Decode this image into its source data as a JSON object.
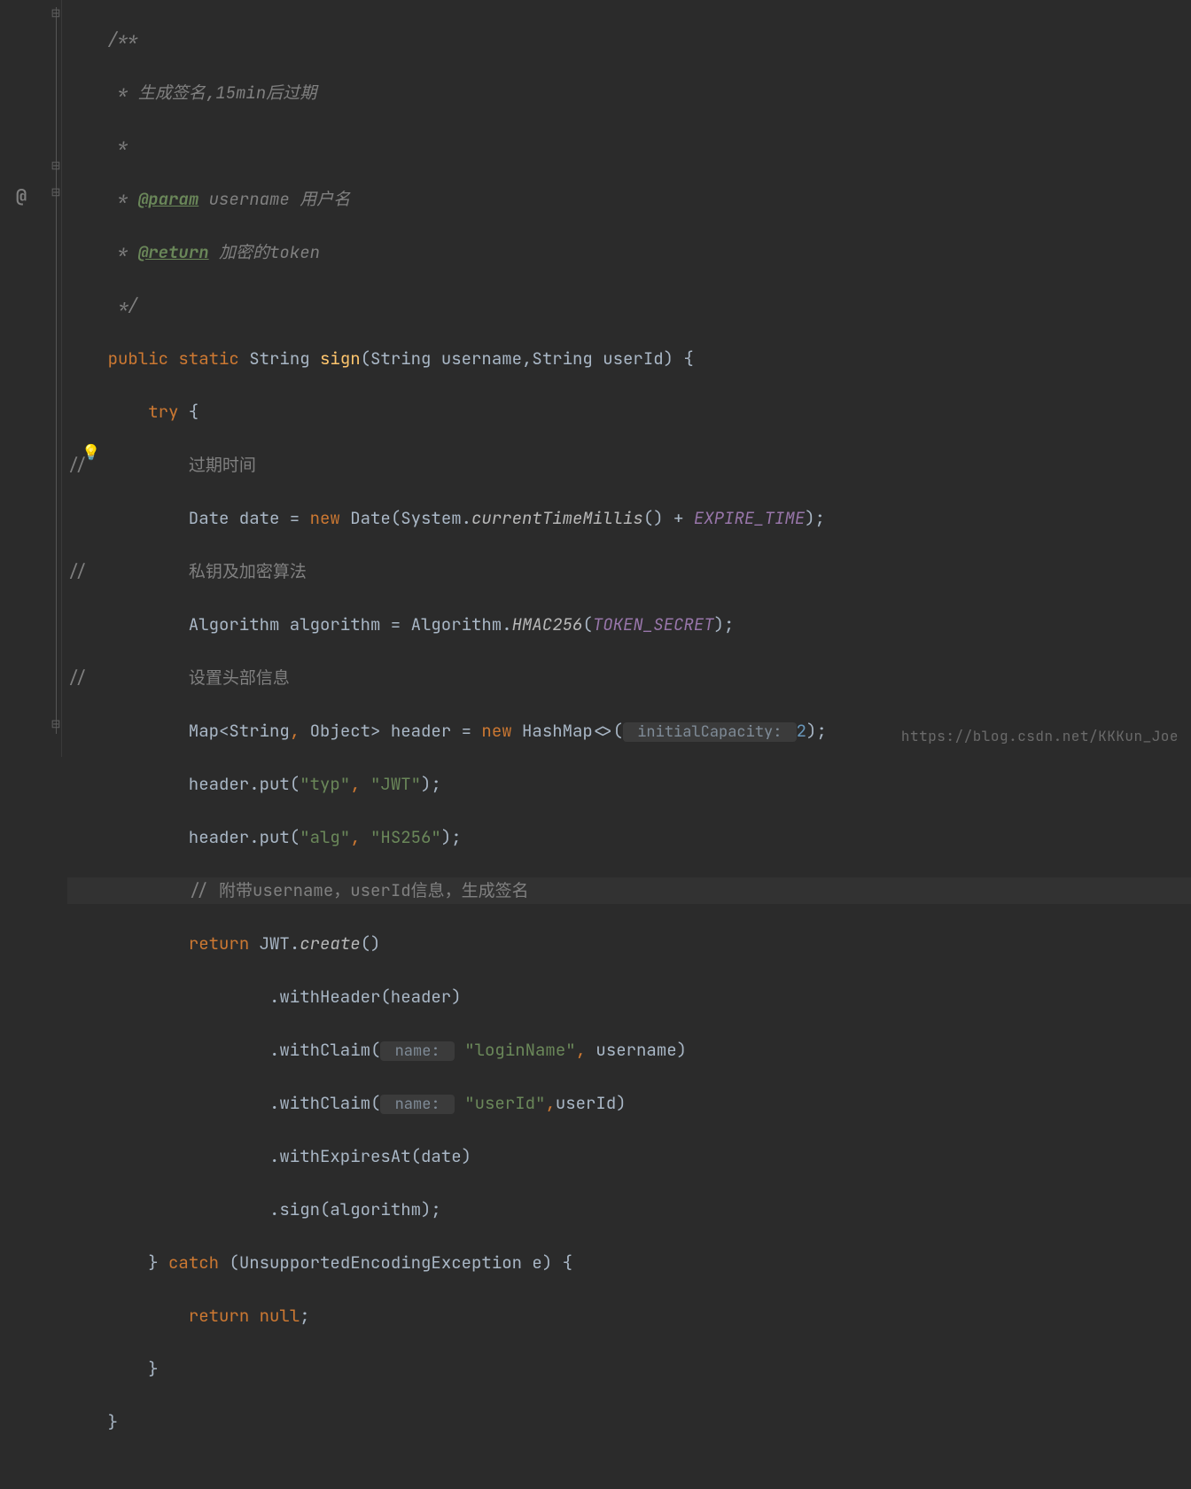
{
  "lines": {
    "l1": "    /**",
    "l2a": "     * ",
    "l2b": "生成签名,15min后过期",
    "l3": "     *",
    "l4a": "     * ",
    "l4b": "@param",
    "l4c": " username ",
    "l4d": "用户名",
    "l5a": "     * ",
    "l5b": "@return",
    "l5c": " 加密的token",
    "l6": "     */",
    "l7a": "    ",
    "l7b": "public static",
    "l7c": " String ",
    "l7d": "sign",
    "l7e": "(String username,String userId) {",
    "l8a": "        ",
    "l8b": "try",
    "l8c": " {",
    "l9a": "//          ",
    "l9b": "过期时间",
    "l10a": "            Date date = ",
    "l10b": "new",
    "l10c": " Date(System.",
    "l10d": "currentTimeMillis",
    "l10e": "() + ",
    "l10f": "EXPIRE_TIME",
    "l10g": ");",
    "l11a": "//          ",
    "l11b": "私钥及加密算法",
    "l12a": "            Algorithm algorithm = Algorithm.",
    "l12b": "HMAC256",
    "l12c": "(",
    "l12d": "TOKEN_SECRET",
    "l12e": ");",
    "l13a": "//          ",
    "l13b": "设置头部信息",
    "l14a": "            Map<String",
    "l14comma1": ",",
    "l14b": " Object> header = ",
    "l14c": "new",
    "l14d": " HashMap<>(",
    "l14hint": " initialCapacity: ",
    "l14e": "2",
    "l14f": ");",
    "l15a": "            header.put(",
    "l15b": "\"typ\"",
    "l15comma": ",",
    "l15c": " ",
    "l15d": "\"JWT\"",
    "l15e": ");",
    "l16a": "            header.put(",
    "l16b": "\"alg\"",
    "l16comma": ",",
    "l16c": " ",
    "l16d": "\"HS256\"",
    "l16e": ");",
    "l17a": "            ",
    "l17b": "// ",
    "l17c": "附带username，userId信息，生成签名",
    "l18a": "            ",
    "l18b": "return",
    "l18c": " JWT.",
    "l18d": "create",
    "l18e": "()",
    "l19": "                    .withHeader(header)",
    "l20a": "                    .withClaim(",
    "l20hint": " name: ",
    "l20b": " ",
    "l20c": "\"loginName\"",
    "l20comma": ",",
    "l20d": " username)",
    "l21a": "                    .withClaim(",
    "l21hint": " name: ",
    "l21b": " ",
    "l21c": "\"userId\"",
    "l21comma": ",",
    "l21d": "userId)",
    "l22": "                    .withExpiresAt(date)",
    "l23": "                    .sign(algorithm);",
    "l24a": "        } ",
    "l24b": "catch",
    "l24c": " (UnsupportedEncodingException e) {",
    "l25a": "            ",
    "l25b": "return null",
    "l25c": ";",
    "l26": "        }",
    "l27": "    }"
  },
  "gutter": {
    "fold_open": "⊟",
    "fold_close": "⊟",
    "annotation": "@",
    "bulb": "💡"
  },
  "watermark": "https://blog.csdn.net/KKKun_Joe"
}
